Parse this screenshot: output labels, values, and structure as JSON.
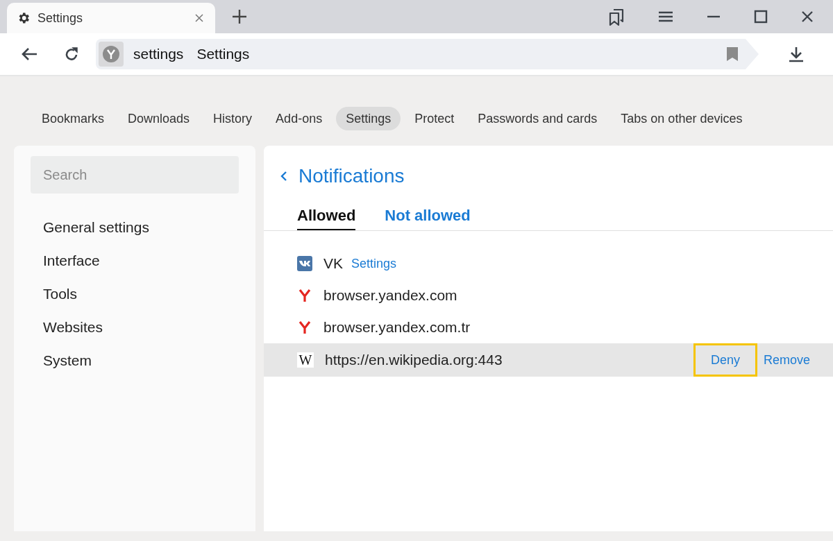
{
  "browser_tab": {
    "title": "Settings",
    "selected": true
  },
  "address": {
    "host": "settings",
    "title": "Settings"
  },
  "nav": [
    {
      "label": "Bookmarks",
      "selected": false
    },
    {
      "label": "Downloads",
      "selected": false
    },
    {
      "label": "History",
      "selected": false
    },
    {
      "label": "Add-ons",
      "selected": false
    },
    {
      "label": "Settings",
      "selected": true
    },
    {
      "label": "Protect",
      "selected": false
    },
    {
      "label": "Passwords and cards",
      "selected": false
    },
    {
      "label": "Tabs on other devices",
      "selected": false
    }
  ],
  "sidebar": {
    "search": {
      "placeholder": "Search"
    },
    "items": [
      {
        "label": "General settings"
      },
      {
        "label": "Interface"
      },
      {
        "label": "Tools"
      },
      {
        "label": "Websites"
      },
      {
        "label": "System"
      }
    ]
  },
  "page": {
    "title": "Notifications",
    "tabs": [
      {
        "label": "Allowed",
        "selected": true
      },
      {
        "label": "Not allowed",
        "selected": false
      }
    ],
    "sites": [
      {
        "kind": "vk",
        "name": "VK",
        "link": "Settings",
        "hovered": false
      },
      {
        "kind": "yandex",
        "name": "browser.yandex.com",
        "hovered": false
      },
      {
        "kind": "yandex",
        "name": "browser.yandex.com.tr",
        "hovered": false
      },
      {
        "kind": "wikipedia",
        "icon_glyph": "W",
        "name": "https://en.wikipedia.org:443",
        "hovered": true,
        "actions": [
          {
            "label": "Deny",
            "highlighted": true
          },
          {
            "label": "Remove",
            "highlighted": false
          }
        ]
      }
    ]
  }
}
